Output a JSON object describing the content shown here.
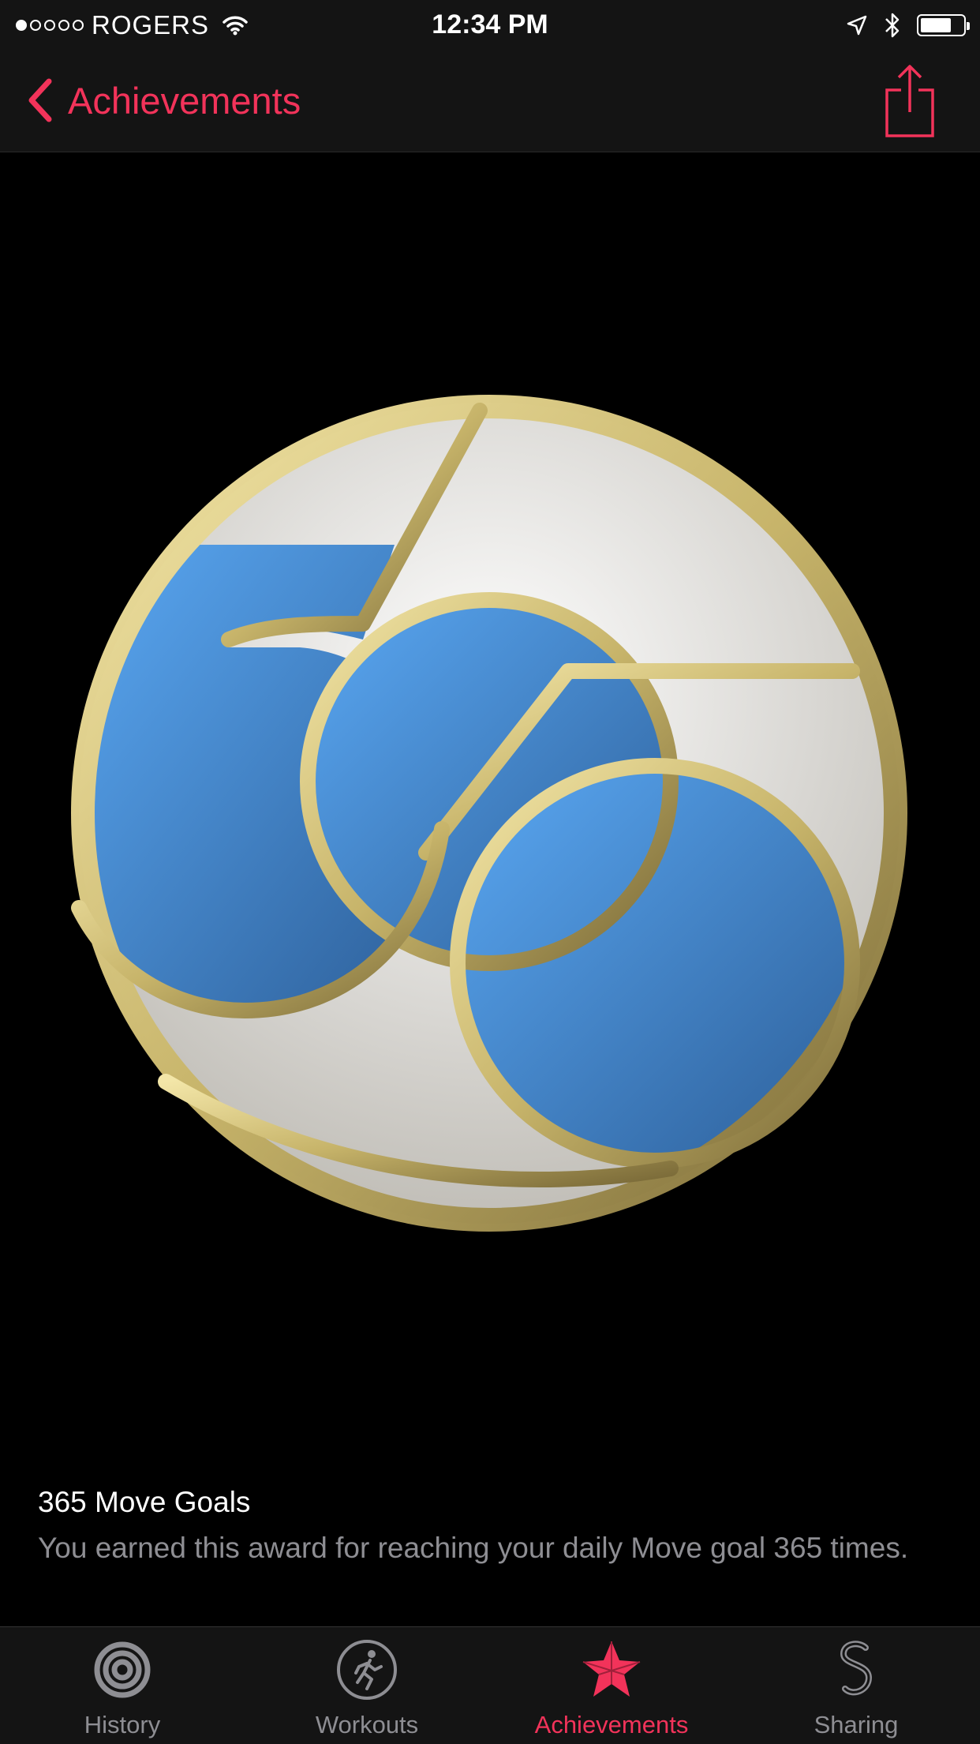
{
  "status_bar": {
    "carrier": "ROGERS",
    "time": "12:34 PM"
  },
  "nav": {
    "back_label": "Achievements"
  },
  "badge": {
    "label": "365"
  },
  "achievement": {
    "title": "365 Move Goals",
    "description": "You earned this award for reaching your daily Move goal 365 times."
  },
  "tabs": [
    {
      "label": "History",
      "icon": "history-rings-icon",
      "active": false
    },
    {
      "label": "Workouts",
      "icon": "running-figure-icon",
      "active": false
    },
    {
      "label": "Achievements",
      "icon": "achievement-star-icon",
      "active": true
    },
    {
      "label": "Sharing",
      "icon": "sharing-s-icon",
      "active": false
    }
  ],
  "colors": {
    "accent": "#f2335a",
    "badge_gold": "#c7b46a",
    "badge_blue": "#3b8fe0",
    "badge_white": "#e8e6e0"
  }
}
